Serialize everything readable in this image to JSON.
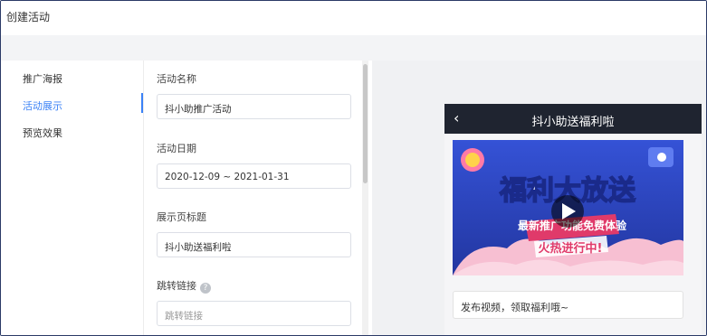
{
  "header": {
    "title": "创建活动"
  },
  "nav": {
    "items": [
      {
        "label": "推广海报",
        "active": false
      },
      {
        "label": "活动展示",
        "active": true
      },
      {
        "label": "预览效果",
        "active": false
      }
    ]
  },
  "form": {
    "name": {
      "label": "活动名称",
      "value": "抖小助推广活动"
    },
    "date": {
      "label": "活动日期",
      "value": "2020-12-09 ~ 2021-01-31"
    },
    "page_title": {
      "label": "展示页标题",
      "value": "抖小助送福利啦"
    },
    "link": {
      "label": "跳转链接",
      "placeholder": "跳转链接",
      "help_icon": "question-circle-icon"
    }
  },
  "preview": {
    "title": "抖小助送福利啦",
    "back_icon": "chevron-left-icon",
    "banner": {
      "headline": "福利大放送",
      "subline": "最新推广功能免费体验",
      "tagline": "火热进行中!",
      "play_icon": "play-icon"
    },
    "post_text": "发布视频，领取福利哦~"
  },
  "colors": {
    "accent": "#3b82f6",
    "phone_header": "#1f2430",
    "banner_bg": "#2a3fb3"
  }
}
